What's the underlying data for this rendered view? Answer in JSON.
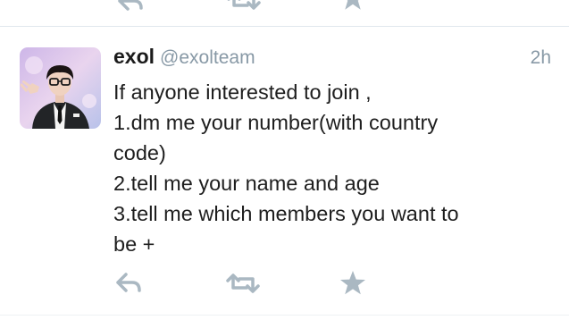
{
  "previous_tweet": {
    "actions": [
      {
        "icon": "reply-icon"
      },
      {
        "icon": "retweet-icon"
      },
      {
        "icon": "favorite-star-icon"
      }
    ]
  },
  "tweet": {
    "avatar_icon": "profile-photo",
    "display_name": "exol",
    "handle": "@exolteam",
    "time": "2h",
    "lines": [
      "If anyone interested to join ,",
      "1.dm me your number(with country",
      "code)",
      "2.tell me your name and age",
      "3.tell me which members you want to",
      "be +"
    ],
    "actions": [
      {
        "icon": "reply-icon"
      },
      {
        "icon": "retweet-icon"
      },
      {
        "icon": "favorite-star-icon"
      }
    ]
  },
  "colors": {
    "action_icon": "#aab8c2",
    "muted_text": "#8899a6",
    "divider": "#e1e8ed"
  }
}
